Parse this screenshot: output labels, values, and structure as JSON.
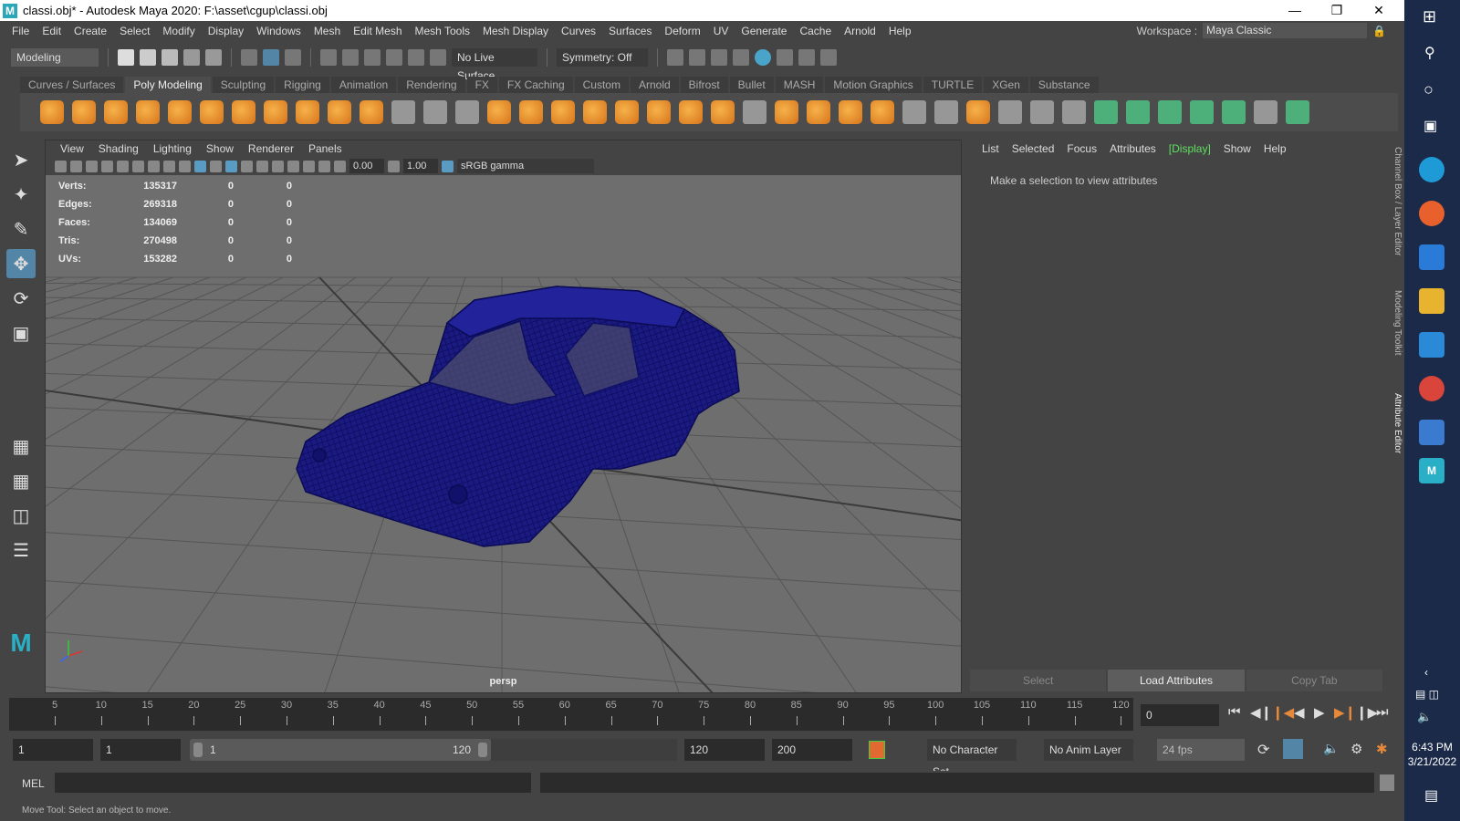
{
  "window": {
    "title": "classi.obj* - Autodesk Maya 2020: F:\\asset\\cgup\\classi.obj",
    "logo": "M"
  },
  "menu": [
    "File",
    "Edit",
    "Create",
    "Select",
    "Modify",
    "Display",
    "Windows",
    "Mesh",
    "Edit Mesh",
    "Mesh Tools",
    "Mesh Display",
    "Curves",
    "Surfaces",
    "Deform",
    "UV",
    "Generate",
    "Cache",
    "Arnold",
    "Help"
  ],
  "workspace": {
    "label": "Workspace :",
    "value": "Maya Classic"
  },
  "toolbar": {
    "mode": "Modeling",
    "live_surface": "No Live Surface",
    "symmetry": "Symmetry: Off"
  },
  "shelf_tabs": [
    "Curves / Surfaces",
    "Poly Modeling",
    "Sculpting",
    "Rigging",
    "Animation",
    "Rendering",
    "FX",
    "FX Caching",
    "Custom",
    "Arnold",
    "Bifrost",
    "Bullet",
    "MASH",
    "Motion Graphics",
    "TURTLE",
    "XGen",
    "Substance"
  ],
  "shelf_active": "Poly Modeling",
  "viewport": {
    "menu": [
      "View",
      "Shading",
      "Lighting",
      "Show",
      "Renderer",
      "Panels"
    ],
    "exposure": "0.00",
    "gamma": "1.00",
    "colorspace": "sRGB gamma",
    "camera": "persp",
    "stats": [
      {
        "label": "Verts:",
        "v": "135317",
        "a": "0",
        "b": "0"
      },
      {
        "label": "Edges:",
        "v": "269318",
        "a": "0",
        "b": "0"
      },
      {
        "label": "Faces:",
        "v": "134069",
        "a": "0",
        "b": "0"
      },
      {
        "label": "Tris:",
        "v": "270498",
        "a": "0",
        "b": "0"
      },
      {
        "label": "UVs:",
        "v": "153282",
        "a": "0",
        "b": "0"
      }
    ]
  },
  "channel_box": {
    "menu": [
      "List",
      "Selected",
      "Focus",
      "Attributes",
      "[Display]",
      "Show",
      "Help"
    ],
    "message": "Make a selection to view attributes",
    "buttons": [
      "Select",
      "Load Attributes",
      "Copy Tab"
    ],
    "side_tabs": [
      "Channel Box / Layer Editor",
      "Modeling Toolkit",
      "Attribute Editor"
    ]
  },
  "timeline": {
    "ticks": [
      "5",
      "10",
      "15",
      "20",
      "25",
      "30",
      "35",
      "40",
      "45",
      "50",
      "55",
      "60",
      "65",
      "70",
      "75",
      "80",
      "85",
      "90",
      "95",
      "100",
      "105",
      "110",
      "115",
      "120"
    ],
    "current": "0"
  },
  "range": {
    "start": "1",
    "anim_start": "1",
    "slider_start": "1",
    "slider_end": "120",
    "end": "120",
    "anim_end": "200",
    "character_set": "No Character Set",
    "anim_layer": "No Anim Layer",
    "fps": "24 fps"
  },
  "mel": {
    "label": "MEL"
  },
  "status": "Move Tool: Select an object to move.",
  "clock": {
    "time": "6:43 PM",
    "date": "3/21/2022"
  }
}
